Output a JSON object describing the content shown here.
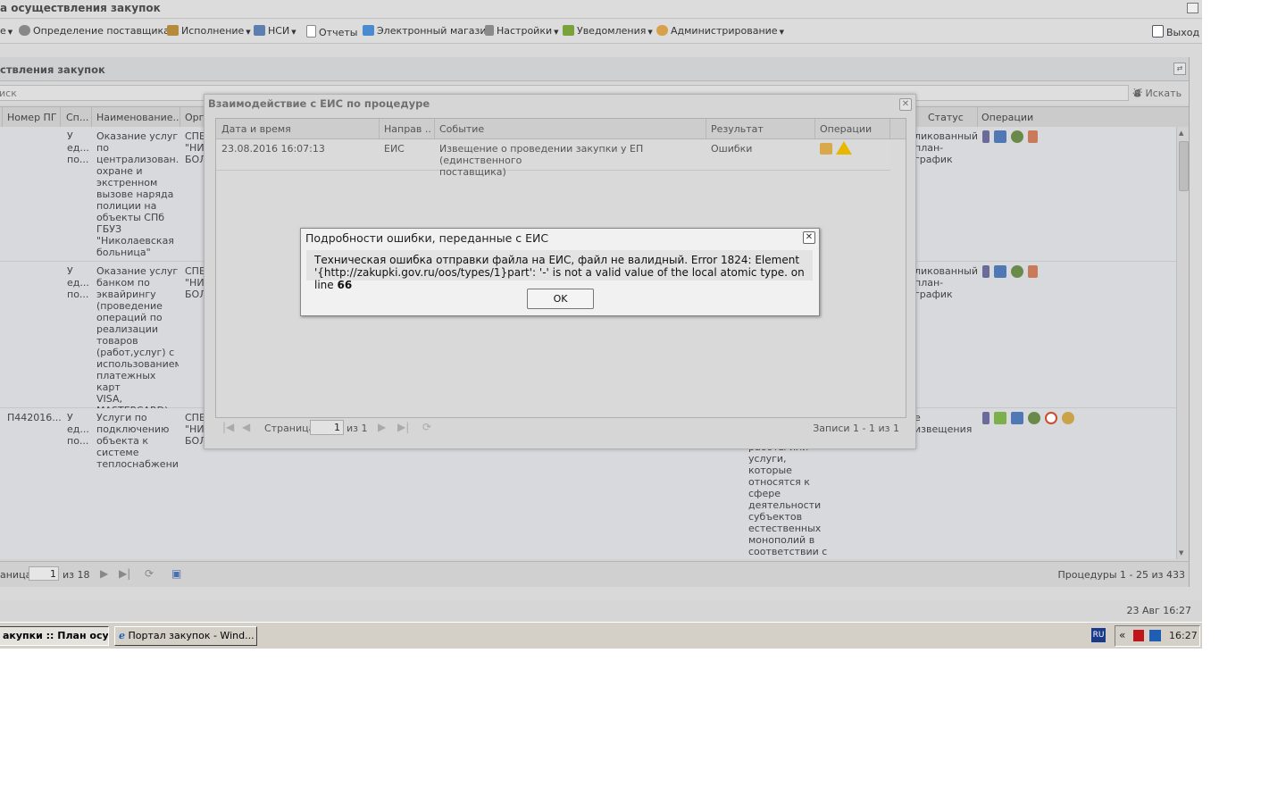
{
  "window": {
    "title": "а осуществления закупок"
  },
  "menu": {
    "items": [
      {
        "label": "",
        "icon": "menu-left-cut-icon"
      },
      {
        "label": "Определение поставщика",
        "icon": "gear-icon"
      },
      {
        "label": "Исполнение",
        "icon": "execution-icon"
      },
      {
        "label": "НСИ",
        "icon": "book-icon"
      },
      {
        "label": "Отчеты",
        "icon": "report-icon"
      },
      {
        "label": "Электронный магазин",
        "icon": "cart-icon"
      },
      {
        "label": "Настройки",
        "icon": "wrench-icon"
      },
      {
        "label": "Уведомления",
        "icon": "notification-icon"
      },
      {
        "label": "Администрирование",
        "icon": "user-icon"
      }
    ],
    "exit_label": "Выход"
  },
  "panel": {
    "title": "ствления закупок"
  },
  "search": {
    "placeholder": "иск",
    "button_label": "Искать"
  },
  "grid": {
    "columns": [
      "Номер ПГ",
      "Сп...",
      "Наименование...",
      "Орга",
      "Статус",
      "Операции"
    ],
    "rows": [
      {
        "number": "",
        "method": "У\nед...\nпо...",
        "name": "Оказание услуг\nпо\nцентрализован...\nохране и\nэкстренном\nвызове наряда\nполиции на\nобъекты СПб\nГБУЗ\n\"Николаевская\nбольница\"",
        "org": "СПБ\n\"НИ\nБОЛ",
        "extra": "",
        "status": "ликованный\nплан-график"
      },
      {
        "number": "",
        "method": "У\nед...\nпо...",
        "name": "Оказание услуг\nбанком по\nэквайрингу\n(проведение\nопераций по\nреализации\nтоваров\n(работ,услуг) с\nиспользованием\nплатежных карт\nVISA,\nMASTERCARD)",
        "org": "СПБ\n\"НИ\nБОЛ",
        "extra": "",
        "status": "ликованный\nплан-график"
      },
      {
        "number": "П442016...",
        "method": "У\nед...\nпо...",
        "name": "Услуги по\nподключению\nобъекта к\nсистеме\nтеплоснабжения",
        "org": "СПБ\n\"НИ\nБОЛ",
        "extra": "работы или\nуслуги, которые\nотносятся к\nсфере\nдеятельности\nсубъектов\nестественных\nмонополий в\nсоответствии с\nФедеральным",
        "status": "е извещения"
      }
    ]
  },
  "pager": {
    "page_prefix": "аница",
    "page_value": "1",
    "page_of": "из 18",
    "info": "Процедуры 1 - 25 из 433"
  },
  "status_time": "23 Авг 16:27",
  "dialog": {
    "title": "Взаимодействие с ЕИС по процедуре",
    "columns": [
      "Дата и время",
      "Направ ...",
      "Событие",
      "Результат",
      "Операции"
    ],
    "row": {
      "datetime": "23.08.2016 16:07:13",
      "direction": "ЕИС",
      "event": "Извещение о проведении закупки у ЕП (единственного\nпоставщика)",
      "result": "Ошибки"
    },
    "pager": {
      "page_label": "Страница",
      "page_value": "1",
      "page_of": "из 1",
      "info": "Записи 1 - 1 из 1"
    }
  },
  "error_dialog": {
    "title": "Подробности ошибки, переданные с ЕИС",
    "message_line1": "Техническая ошибка отправки файла на ЕИС, файл не валидный. Error 1824: Element",
    "message_line2": "'{http://zakupki.gov.ru/oos/types/1}part': '-' is not a valid value of the local atomic type. on line ",
    "message_line_number": "66",
    "ok_label": "OK"
  },
  "taskbar": {
    "tasks": [
      {
        "label": "акупки :: План осущ..."
      },
      {
        "label": "Портал закупок - Wind..."
      }
    ],
    "lang": "RU",
    "tray_chevron": "«",
    "clock": "16:27"
  },
  "colors": {
    "accent_orange": "#d98c1a",
    "warning_yellow": "#e8b800",
    "ie_blue": "#1e5fb5",
    "kaspersky_red": "#c0161b"
  }
}
